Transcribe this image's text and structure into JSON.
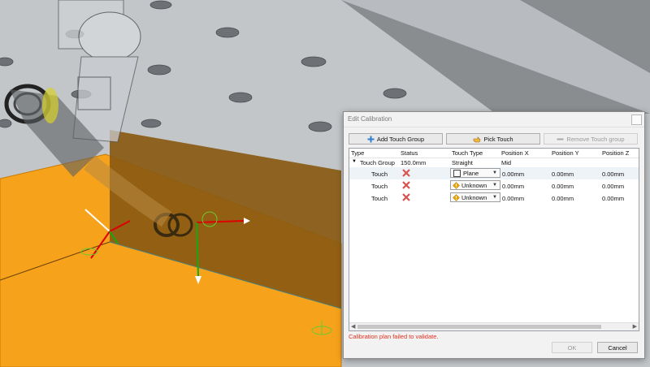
{
  "dialog": {
    "title": "Edit Calibration",
    "buttons": {
      "add_touch_group": "Add Touch Group",
      "pick_touch": "Pick Touch",
      "remove_touch_group": "Remove Touch group"
    },
    "columns": [
      "Type",
      "Status",
      "Touch Type",
      "Position X",
      "Position Y",
      "Position Z"
    ],
    "group_row": {
      "type": "Touch Group",
      "status": "150.0mm",
      "touch_type": "Straight",
      "position_x": "Mid"
    },
    "touch_rows": [
      {
        "type": "Touch",
        "status_icon": "fail-x-icon",
        "touch_type": "Plane",
        "touch_type_icon": "plane-icon",
        "x": "0.00mm",
        "y": "0.00mm",
        "z": "0.00mm"
      },
      {
        "type": "Touch",
        "status_icon": "fail-x-icon",
        "touch_type": "Unknown",
        "touch_type_icon": "warning-diamond-icon",
        "x": "0.00mm",
        "y": "0.00mm",
        "z": "0.00mm"
      },
      {
        "type": "Touch",
        "status_icon": "fail-x-icon",
        "touch_type": "Unknown",
        "touch_type_icon": "warning-diamond-icon",
        "x": "0.00mm",
        "y": "0.00mm",
        "z": "0.00mm"
      }
    ],
    "error_message": "Calibration plan failed to validate.",
    "ok_label": "OK",
    "cancel_label": "Cancel"
  },
  "colors": {
    "error": "#e0301e",
    "orange_plate": "#f7a21b",
    "brown_wall": "#8a5a12",
    "fail_x": "#d9534f",
    "warning": "#f0a400"
  }
}
